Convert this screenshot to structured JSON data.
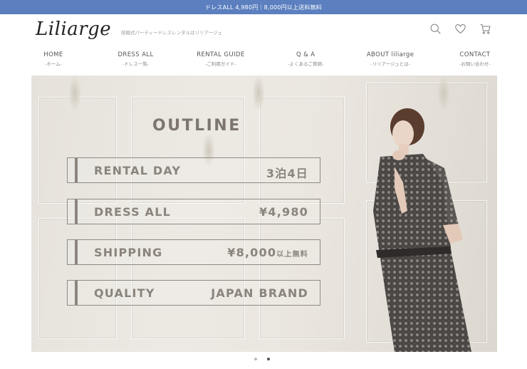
{
  "announcement": "ドレスALL 4,980円｜8,000円以上送料無料",
  "header": {
    "logo": "Liliarge",
    "tagline": "結婚式パーティードレスレンタルはリリアージュ",
    "icons": [
      "search-icon",
      "heart-icon",
      "cart-icon"
    ]
  },
  "nav": [
    {
      "en": "HOME",
      "jp": "-ホーム-"
    },
    {
      "en": "DRESS ALL",
      "jp": "-ドレス一覧-"
    },
    {
      "en": "RENTAL GUIDE",
      "jp": "-ご利用ガイド-"
    },
    {
      "en": "Q & A",
      "jp": "-よくあるご質問-"
    },
    {
      "en": "ABOUT liliarge",
      "jp": "-リリアージュとは-"
    },
    {
      "en": "CONTACT",
      "jp": "-お問い合わせ-"
    }
  ],
  "hero": {
    "title": "OUTLINE",
    "rows": [
      {
        "label": "RENTAL DAY",
        "value": "3泊4日",
        "suffix": ""
      },
      {
        "label": "DRESS ALL",
        "value": "¥4,980",
        "suffix": ""
      },
      {
        "label": "SHIPPING",
        "value": "¥8,000",
        "suffix": "以上無料"
      },
      {
        "label": "QUALITY",
        "value": "JAPAN BRAND",
        "suffix": ""
      }
    ]
  },
  "carousel": {
    "active_slide": 2
  },
  "colors": {
    "topbar": "#5b7fbf",
    "text_muted": "#8a847c"
  }
}
